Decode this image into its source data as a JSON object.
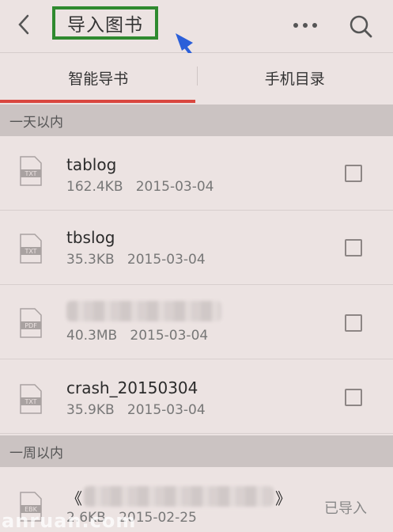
{
  "header": {
    "title": "导入图书",
    "back_icon": "chevron-left-icon",
    "more_icon": "more-icon",
    "search_icon": "search-icon",
    "annotation_color": "#2f8a2f",
    "arrow_color": "#2b5fd9"
  },
  "tabs": [
    {
      "label": "智能导书",
      "active": true
    },
    {
      "label": "手机目录",
      "active": false
    }
  ],
  "accent_color": "#d9473f",
  "sections": [
    {
      "label": "一天以内",
      "files": [
        {
          "name": "tablog",
          "size": "162.4KB",
          "date": "2015-03-04",
          "type": "TXT"
        },
        {
          "name": "tbslog",
          "size": "35.3KB",
          "date": "2015-03-04",
          "type": "TXT"
        },
        {
          "name": "",
          "size": "40.3MB",
          "date": "2015-03-04",
          "type": "PDF"
        },
        {
          "name": "crash_20150304",
          "size": "35.9KB",
          "date": "2015-03-04",
          "type": "TXT"
        }
      ]
    },
    {
      "label": "一周以内",
      "files": [
        {
          "name": "《",
          "name_end": "》",
          "size": "2.6KB",
          "date": "2015-02-25",
          "type": "EBK",
          "status": "已导入"
        }
      ]
    }
  ],
  "watermark": "anruan.com"
}
